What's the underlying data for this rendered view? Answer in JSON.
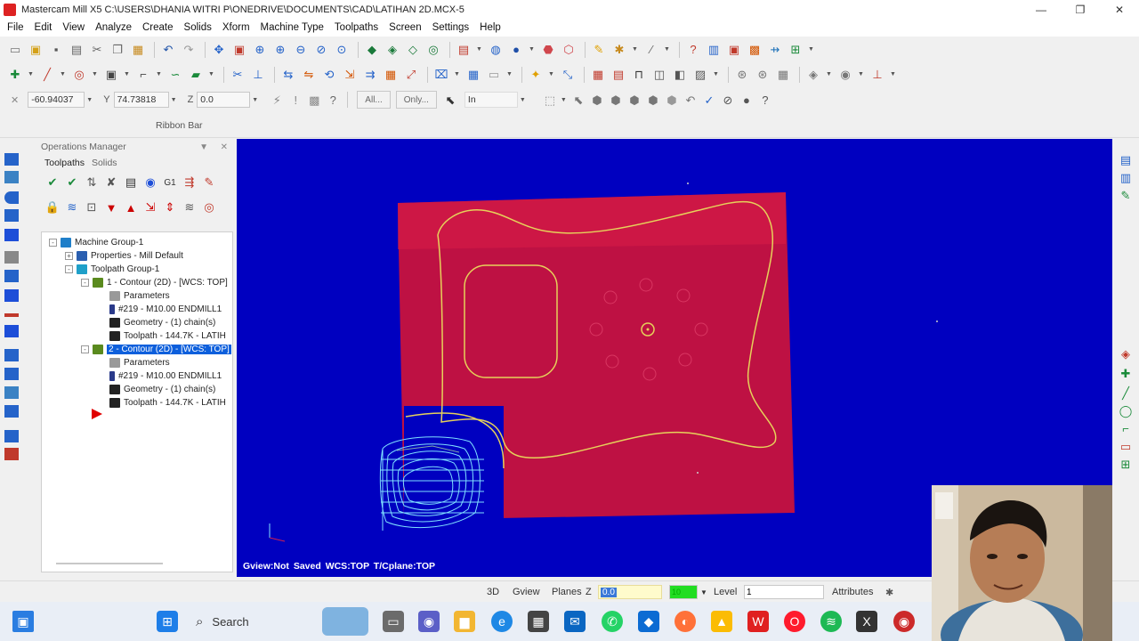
{
  "window": {
    "title": "Mastercam Mill X5  C:\\USERS\\DHANIA WITRI P\\ONEDRIVE\\DOCUMENTS\\CAD\\LATIHAN 2D.MCX-5",
    "minimize": "—",
    "maximize": "❐",
    "close": "✕"
  },
  "menu": [
    "File",
    "Edit",
    "View",
    "Analyze",
    "Create",
    "Solids",
    "Xform",
    "Machine Type",
    "Toolpaths",
    "Screen",
    "Settings",
    "Help"
  ],
  "ribbon": {
    "x_label": "X",
    "x_value": "-60.94037",
    "y_label": "Y",
    "y_value": "74.73818",
    "z_label": "Z",
    "z_value": "0.0",
    "all_button": "All...",
    "only_button": "Only...",
    "mode_value": "In",
    "caption": "Ribbon Bar"
  },
  "operations_manager": {
    "title": "Operations Manager",
    "tabs": [
      "Toolpaths",
      "Solids"
    ],
    "tree": [
      {
        "label": "Machine Group-1",
        "level": 0,
        "expander": "-"
      },
      {
        "label": "Properties - Mill Default",
        "level": 1,
        "expander": "+"
      },
      {
        "label": "Toolpath Group-1",
        "level": 1,
        "expander": "-"
      },
      {
        "label": "1 - Contour (2D) - [WCS: TOP]",
        "level": 2,
        "expander": "-"
      },
      {
        "label": "Parameters",
        "level": 3
      },
      {
        "label": "#219 - M10.00 ENDMILL1",
        "level": 3
      },
      {
        "label": "Geometry - (1) chain(s)",
        "level": 3
      },
      {
        "label": "Toolpath - 144.7K - LATIH",
        "level": 3
      },
      {
        "label": "2 - Contour (2D) - [WCS: TOP]",
        "level": 2,
        "expander": "-",
        "selected": true
      },
      {
        "label": "Parameters",
        "level": 3
      },
      {
        "label": "#219 - M10.00 ENDMILL1",
        "level": 3
      },
      {
        "label": "Geometry - (1) chain(s)",
        "level": 3
      },
      {
        "label": "Toolpath - 144.7K - LATIH",
        "level": 3
      }
    ]
  },
  "viewport": {
    "status": "Gview:Not Saved   WCS:TOP   T/Cplane:TOP",
    "background": "#0000c0",
    "stock_color": "#c8123c",
    "geometry_color": "#e6d15a",
    "toolpath_color": "#7fe0ff"
  },
  "statusbar": {
    "mode_3d": "3D",
    "gview": "Gview",
    "planes": "Planes",
    "z_label": "Z",
    "z_value": "0.0",
    "color_value": "10",
    "level_label": "Level",
    "level_value": "1",
    "attributes": "Attributes"
  },
  "taskbar": {
    "search_label": "Search"
  }
}
